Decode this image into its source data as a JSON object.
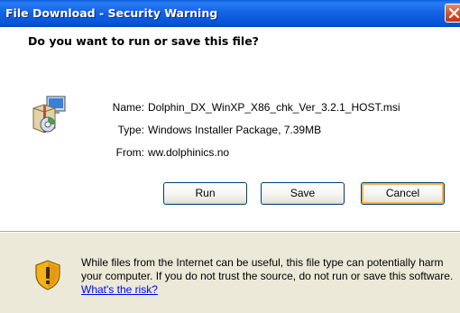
{
  "window": {
    "title": "File Download - Security Warning"
  },
  "dialog": {
    "question": "Do you want to run or save this file?",
    "fields": [
      {
        "label": "Name:",
        "value": "Dolphin_DX_WinXP_X86_chk_Ver_3.2.1_HOST.msi"
      },
      {
        "label": "Type:",
        "value": "Windows Installer Package, 7.39MB"
      },
      {
        "label": "From:",
        "value": "ww.dolphinics.no"
      }
    ],
    "buttons": {
      "run": "Run",
      "save": "Save",
      "cancel": "Cancel"
    },
    "warning": {
      "text": "While files from the Internet can be useful, this file type can potentially harm your computer. If you do not trust the source, do not run or save this software. ",
      "link": "What's the risk?"
    }
  },
  "icons": {
    "file": "installer-package-icon",
    "warning": "security-shield-icon",
    "close": "close-icon"
  },
  "colors": {
    "titlebar": "#0653d4",
    "dialog_bg": "#ece9d8",
    "close_button": "#d44a2a",
    "default_button_focus": "#f8b54a",
    "link": "#0000ff"
  }
}
